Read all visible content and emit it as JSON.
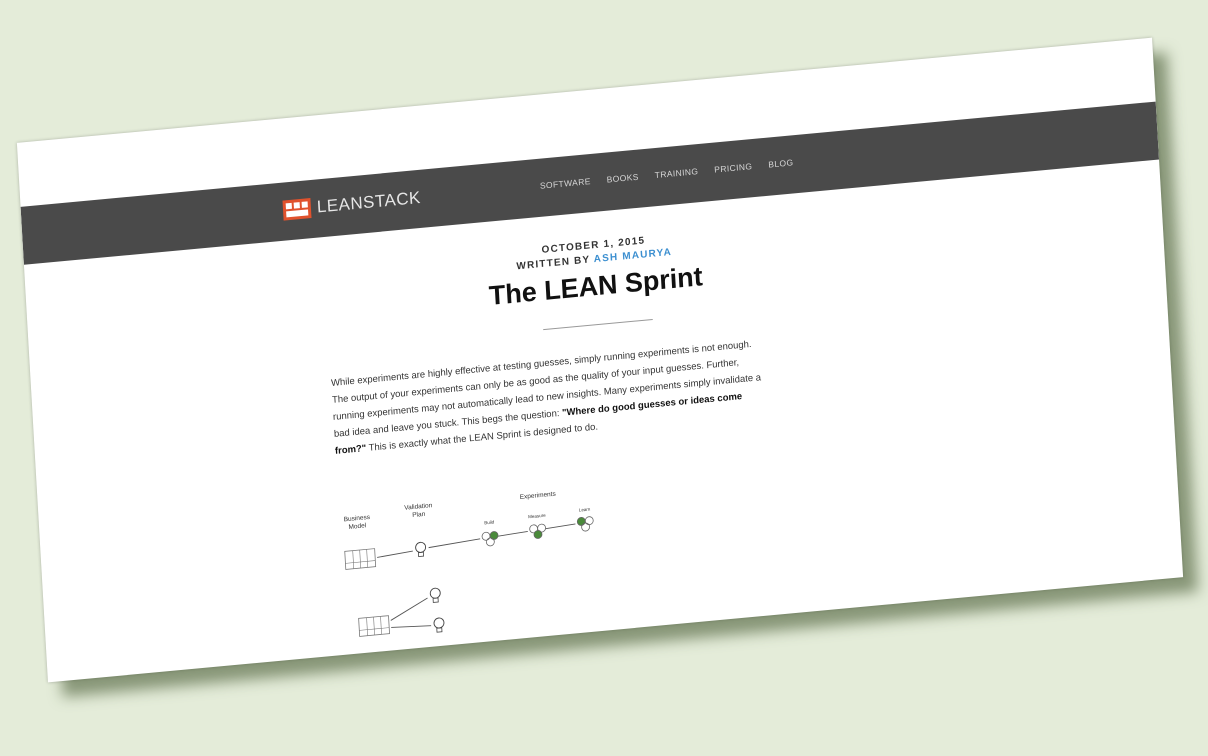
{
  "nav": {
    "brand": "LEANSTACK",
    "links": [
      "SOFTWARE",
      "BOOKS",
      "TRAINING",
      "PRICING",
      "BLOG"
    ]
  },
  "article": {
    "date": "OCTOBER 1, 2015",
    "written_by": "WRITTEN BY",
    "author": "ASH MAURYA",
    "title": "The LEAN Sprint",
    "body_pre": "While experiments are highly effective at testing guesses, simply running experiments is not enough. The output of your experiments can only be as good as the quality of your input guesses. Further, running experiments may not automatically lead to new insights. Many experiments simply invalidate a bad idea and leave you stuck. This begs the question: ",
    "body_bold": "\"Where do good guesses or ideas come from?\"",
    "body_post": " This is exactly what the LEAN Sprint is designed to do."
  },
  "diagram": {
    "col_business": "Business",
    "col_business2": "Model",
    "col_validation": "Validation",
    "col_validation2": "Plan",
    "col_experiments": "Experiments",
    "step_build": "Build",
    "step_measure": "Measure",
    "step_learn": "Learn"
  },
  "colors": {
    "navbar": "#4a4a4a",
    "logo_accent": "#e0522d",
    "link_accent": "#3c8fd0",
    "backdrop": "#e4ecd9",
    "node_green": "#4a8a3a"
  }
}
